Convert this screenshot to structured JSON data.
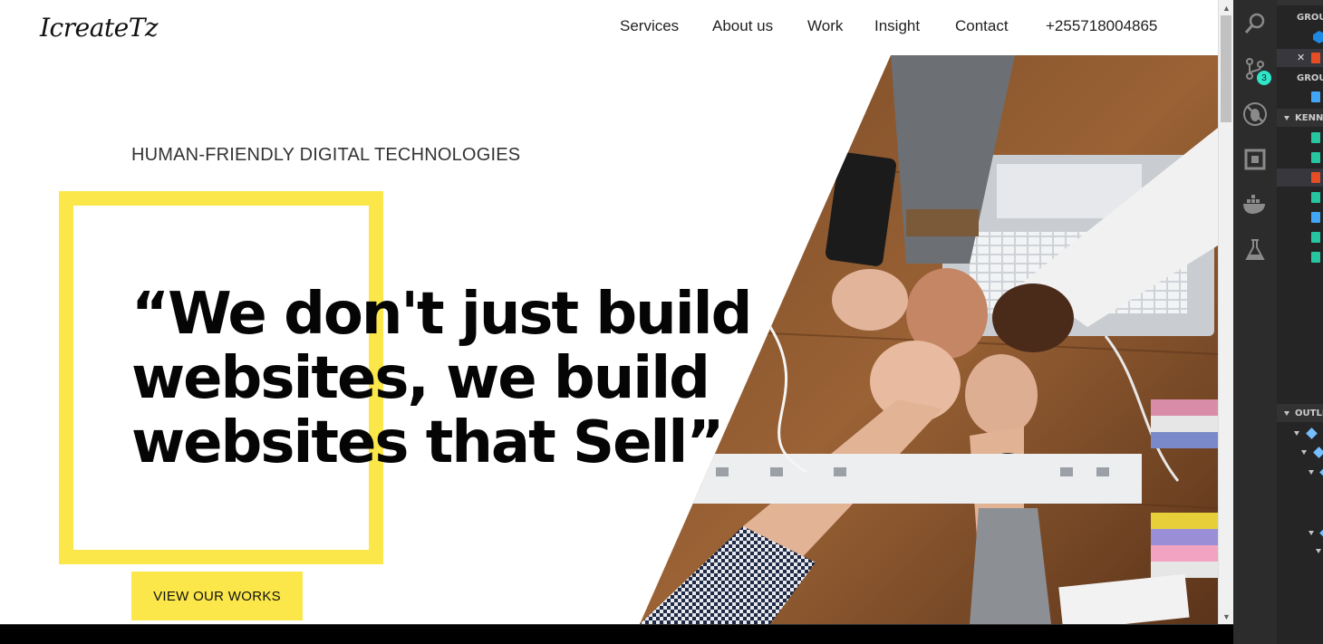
{
  "site": {
    "logo": "IcreateTz",
    "nav": [
      "Services",
      "About us",
      "Work",
      "Insight",
      "Contact",
      "+255718004865"
    ],
    "tagline": "HUMAN-FRIENDLY DIGITAL TECHNOLOGIES",
    "headline_lines": [
      "“We don't just build",
      "websites, we build",
      "websites that Sell”"
    ],
    "cta_label": "VIEW OUR WORKS"
  },
  "editor": {
    "scm_badge": "3",
    "sections": {
      "group1": "GROUP",
      "group2": "GROUP",
      "project": "KENNEDY",
      "outline": "OUTLINE"
    },
    "activity_icons": [
      "search-icon",
      "source-control-icon",
      "debug-icon",
      "extensions-icon",
      "docker-icon",
      "test-flask-icon"
    ]
  },
  "colors": {
    "accent_yellow": "#fbe74a",
    "headline": "#050505",
    "badge": "#2ee6c9",
    "html_icon": "#e44d26",
    "css_icon": "#42a5f5",
    "file_icon": "#26c6a0"
  }
}
